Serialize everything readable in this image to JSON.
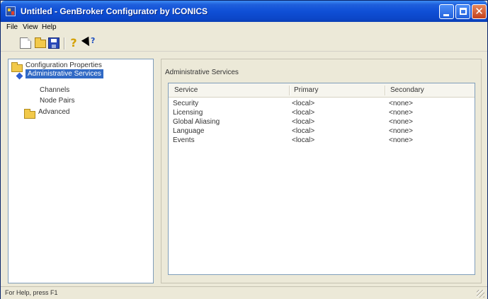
{
  "window": {
    "title": "Untitled - GenBroker Configurator by ICONICS"
  },
  "menu": {
    "items": [
      "File",
      "View",
      "Help"
    ]
  },
  "toolbar": {
    "icons": [
      "new-document-icon",
      "open-folder-icon",
      "save-icon",
      "help-icon",
      "whats-this-help-icon"
    ],
    "help_glyph": "?"
  },
  "tree": {
    "root": {
      "label": "Configuration Properties"
    },
    "items": [
      {
        "label": "Administrative Services",
        "selected": true
      },
      {
        "label": "Channels"
      },
      {
        "label": "Node Pairs"
      }
    ],
    "advanced": {
      "label": "Advanced"
    }
  },
  "panel": {
    "title": "Administrative Services"
  },
  "table": {
    "columns": [
      "Service",
      "Primary",
      "Secondary"
    ],
    "rows": [
      {
        "service": "Security",
        "primary": "<local>",
        "secondary": "<none>"
      },
      {
        "service": "Licensing",
        "primary": "<local>",
        "secondary": "<none>"
      },
      {
        "service": "Global Aliasing",
        "primary": "<local>",
        "secondary": "<none>"
      },
      {
        "service": "Language",
        "primary": "<local>",
        "secondary": "<none>"
      },
      {
        "service": "Events",
        "primary": "<local>",
        "secondary": "<none>"
      }
    ]
  },
  "status": {
    "text": "For Help, press F1"
  },
  "colors": {
    "titlebar": "#0b46c8",
    "selection": "#316ac5",
    "window_face": "#ece9d8"
  }
}
